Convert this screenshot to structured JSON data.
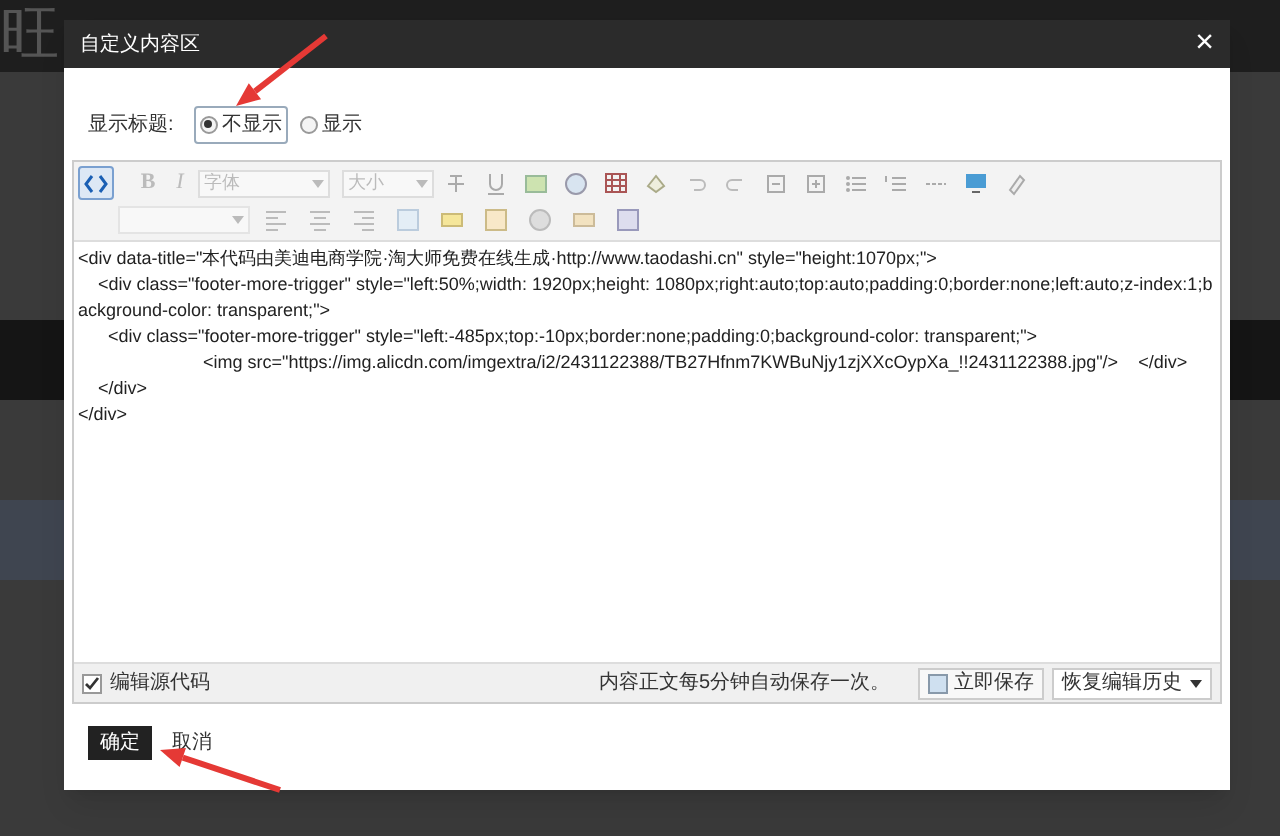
{
  "background": {
    "logo_text": "旺"
  },
  "dialog": {
    "title": "自定义内容区",
    "close": "×"
  },
  "display_title": {
    "label": "显示标题:",
    "options": [
      {
        "label": "不显示",
        "selected": true
      },
      {
        "label": "显示",
        "selected": false
      }
    ]
  },
  "toolbar": {
    "source_button": {
      "selected": true
    },
    "bold": "B",
    "italic": "I",
    "font_select": "字体",
    "size_select": "大小"
  },
  "code_lines": [
    "<div data-title=\"本代码由美迪电商学院·淘大师免费在线生成·http://www.taodashi.cn\" style=\"height:1070px;\">",
    "    <div class=\"footer-more-trigger\" style=\"left:50%;width: 1920px;height: 1080px;right:auto;top:auto;padding:0;border:none;left:auto;z-index:1;background-color: transparent;\">",
    "      <div class=\"footer-more-trigger\" style=\"left:-485px;top:-10px;border:none;padding:0;background-color: transparent;\">",
    "                         <img src=\"https://img.alicdn.com/imgextra/i2/2431122388/TB27Hfnm7KWBuNjy1zjXXcOypXa_!!2431122388.jpg\"/>    </div>",
    "    </div>",
    "</div>"
  ],
  "status_bar": {
    "source_checkbox": {
      "label": "编辑源代码",
      "checked": true
    },
    "autosave_note": "内容正文每5分钟自动保存一次。",
    "save_now": "立即保存",
    "restore_history": "恢复编辑历史"
  },
  "buttons": [
    {
      "label": "确定",
      "kind": "primary"
    },
    {
      "label": "取消",
      "kind": "plain"
    }
  ]
}
